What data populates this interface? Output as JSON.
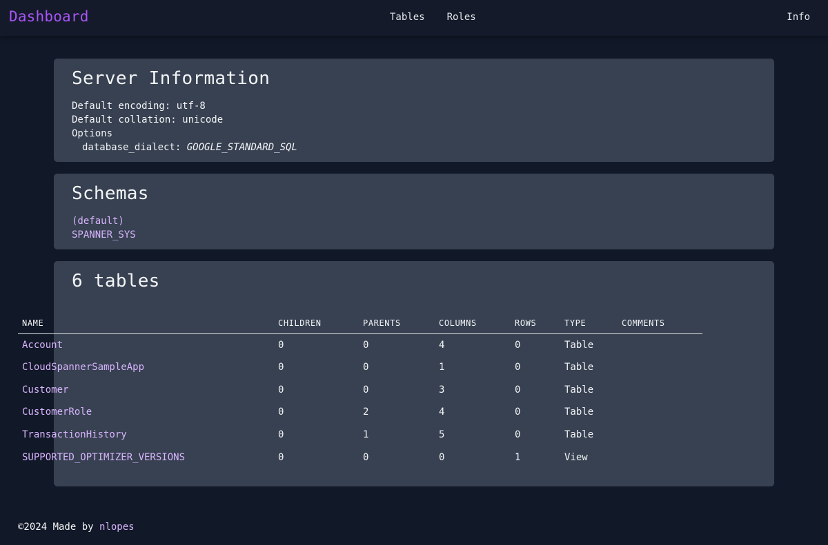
{
  "nav": {
    "brand": "Dashboard",
    "links": [
      "Tables",
      "Roles"
    ],
    "info": "Info"
  },
  "server": {
    "title": "Server Information",
    "encoding_line": "Default encoding: utf-8",
    "collation_line": "Default collation: unicode",
    "options_label": "Options",
    "option_key": "database_dialect:",
    "option_value": "GOOGLE_STANDARD_SQL"
  },
  "schemas": {
    "title": "Schemas",
    "items": [
      "(default)",
      "SPANNER_SYS"
    ]
  },
  "tables": {
    "title": "6 tables",
    "columns": [
      "NAME",
      "CHILDREN",
      "PARENTS",
      "COLUMNS",
      "ROWS",
      "TYPE",
      "COMMENTS"
    ],
    "rows": [
      {
        "name": "Account",
        "children": "0",
        "parents": "0",
        "columns": "4",
        "rows": "0",
        "type": "Table",
        "comments": ""
      },
      {
        "name": "CloudSpannerSampleApp",
        "children": "0",
        "parents": "0",
        "columns": "1",
        "rows": "0",
        "type": "Table",
        "comments": ""
      },
      {
        "name": "Customer",
        "children": "0",
        "parents": "0",
        "columns": "3",
        "rows": "0",
        "type": "Table",
        "comments": ""
      },
      {
        "name": "CustomerRole",
        "children": "0",
        "parents": "2",
        "columns": "4",
        "rows": "0",
        "type": "Table",
        "comments": ""
      },
      {
        "name": "TransactionHistory",
        "children": "0",
        "parents": "1",
        "columns": "5",
        "rows": "0",
        "type": "Table",
        "comments": ""
      },
      {
        "name": "SUPPORTED_OPTIMIZER_VERSIONS",
        "children": "0",
        "parents": "0",
        "columns": "0",
        "rows": "1",
        "type": "View",
        "comments": ""
      }
    ]
  },
  "footer": {
    "text": "©2024 Made by",
    "author": "nlopes"
  },
  "colors": {
    "background": "#111827",
    "card": "#374151",
    "brand": "#a855f7",
    "link": "#d8b4fe"
  }
}
